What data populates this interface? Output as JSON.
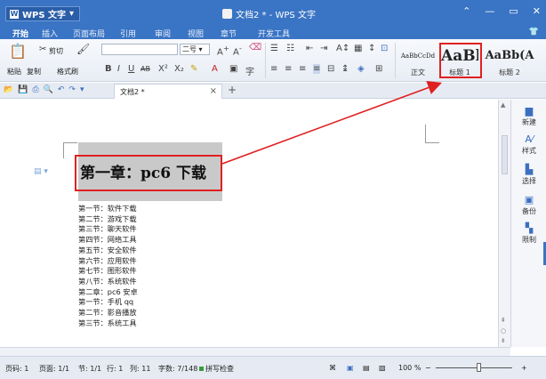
{
  "app": {
    "name": "WPS 文字",
    "doc_title": "文档2 * - WPS 文字"
  },
  "menu": {
    "tabs": [
      {
        "label": "开始"
      },
      {
        "label": "插入"
      },
      {
        "label": "页面布局"
      },
      {
        "label": "引用"
      },
      {
        "label": "审阅"
      },
      {
        "label": "视图"
      },
      {
        "label": "章节"
      },
      {
        "label": "开发工具"
      }
    ]
  },
  "ribbon": {
    "paste": "粘贴",
    "cut": "剪切",
    "copy": "复制",
    "format_painter": "格式刷",
    "font_size": "二号",
    "styles": [
      {
        "preview": "AaBbCcDd",
        "label": "正文"
      },
      {
        "preview": "AaBl",
        "label": "标题 1"
      },
      {
        "preview": "AaBb(A",
        "label": "标题 2"
      }
    ]
  },
  "tabbar": {
    "doc_tab": "文档2 *"
  },
  "document": {
    "heading": "第一章：pc6 下载",
    "lines": [
      "第一节：软件下载",
      "第二节：游戏下载",
      "第三节：聊天软件",
      "第四节：网络工具",
      "第五节：安全软件",
      "第六节：应用软件",
      "第七节：图形软件",
      "第八节：系统软件",
      "第二章：pc6 安卓",
      "第一节：手机 qq",
      "第二节：影音播放",
      "第三节：系统工具"
    ]
  },
  "sidebar": {
    "items": [
      {
        "label": "新建",
        "icon": "new-doc-icon"
      },
      {
        "label": "样式",
        "icon": "style-icon"
      },
      {
        "label": "选择",
        "icon": "select-icon"
      },
      {
        "label": "备份",
        "icon": "backup-icon"
      },
      {
        "label": "限制",
        "icon": "restrict-icon"
      }
    ]
  },
  "status": {
    "page": "页码: 1",
    "pages": "页面: 1/1",
    "section": "节: 1/1",
    "row": "行: 1",
    "col": "列: 11",
    "words": "字数: 7/148",
    "spell": "拼写检查",
    "zoom": "100 %"
  },
  "colors": {
    "accent": "#3a74c4",
    "annotation": "#e02020"
  }
}
